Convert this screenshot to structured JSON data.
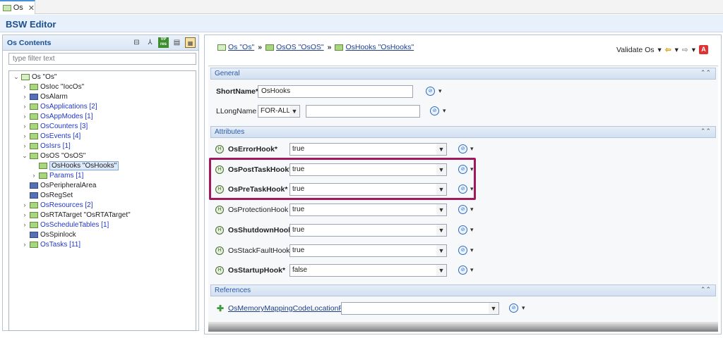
{
  "tab": {
    "label": "Os"
  },
  "editor": {
    "title": "BSW Editor"
  },
  "contents": {
    "title": "Os Contents",
    "filter_placeholder": "type filter text",
    "tree": [
      {
        "label": "Os \"Os\"",
        "style": "black"
      },
      {
        "label": "OsIoc \"IocOs\"",
        "style": "black"
      },
      {
        "label": "OsAlarm",
        "style": "black"
      },
      {
        "label": "OsApplications [2]",
        "style": "blue"
      },
      {
        "label": "OsAppModes [1]",
        "style": "blue"
      },
      {
        "label": "OsCounters [3]",
        "style": "blue"
      },
      {
        "label": "OsEvents [4]",
        "style": "blue"
      },
      {
        "label": "OsIsrs [1]",
        "style": "blue"
      },
      {
        "label": "OsOS \"OsOS\"",
        "style": "black"
      },
      {
        "label": "OsHooks \"OsHooks\"",
        "style": "black"
      },
      {
        "label": "Params [1]",
        "style": "blue"
      },
      {
        "label": "OsPeripheralArea",
        "style": "black"
      },
      {
        "label": "OsRegSet",
        "style": "black"
      },
      {
        "label": "OsResources [2]",
        "style": "blue"
      },
      {
        "label": "OsRTATarget \"OsRTATarget\"",
        "style": "black"
      },
      {
        "label": "OsScheduleTables [1]",
        "style": "blue"
      },
      {
        "label": "OsSpinlock",
        "style": "black"
      },
      {
        "label": "OsTasks [11]",
        "style": "blue"
      }
    ]
  },
  "breadcrumb": [
    "Os \"Os\"",
    "OsOS \"OsOS\"",
    "OsHooks \"OsHooks\""
  ],
  "validate": {
    "label": "Validate Os"
  },
  "general": {
    "title": "General",
    "shortname_label": "ShortName*",
    "shortname_value": "OsHooks",
    "longname_label": "LLongName",
    "longname_lang": "FOR-ALL",
    "longname_value": ""
  },
  "attributes": {
    "title": "Attributes",
    "items": [
      {
        "label": "OsErrorHook*",
        "value": "true",
        "bold": true
      },
      {
        "label": "OsPostTaskHook*",
        "value": "true",
        "bold": true
      },
      {
        "label": "OsPreTaskHook*",
        "value": "true",
        "bold": true
      },
      {
        "label": "OsProtectionHook",
        "value": "true",
        "bold": false
      },
      {
        "label": "OsShutdownHook*",
        "value": "true",
        "bold": true
      },
      {
        "label": "OsStackFaultHook",
        "value": "true",
        "bold": false
      },
      {
        "label": "OsStartupHook*",
        "value": "false",
        "bold": true
      }
    ]
  },
  "references": {
    "title": "References",
    "items": [
      {
        "label": "OsMemoryMappingCodeLocationRef",
        "value": ""
      }
    ]
  },
  "colors": {
    "highlight": "#a0195c",
    "link": "#2338c6",
    "header_text": "#1b4f8f"
  }
}
